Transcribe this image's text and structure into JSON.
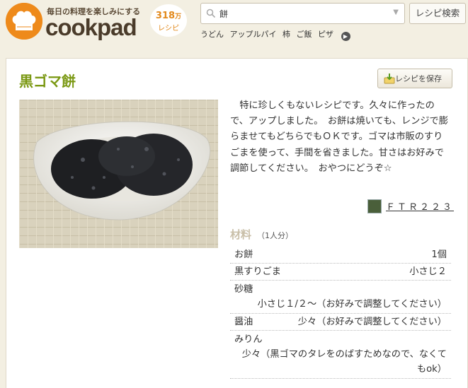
{
  "header": {
    "tagline": "毎日の料理を楽しみにする",
    "logo": "cookpad",
    "count_number": "318",
    "count_unit": "万",
    "count_label": "レシピ",
    "search_value": "餅",
    "search_button": "レシピ検索",
    "keywords": [
      "うどん",
      "アップルパイ",
      "柿",
      "ご飯",
      "ピザ"
    ]
  },
  "recipe": {
    "title": "黒ゴマ餅",
    "save_button": "レシピを保存",
    "description": "特に珍しくもないレシピです。久々に作ったので、アップしました。　お餅は焼いても、レンジで膨らませてもどちらでもＯＫです。ゴマは市販のすりごまを使って、手間を省きました。甘さはお好みで調節してください。　おやつにどうぞ☆",
    "author": "ＦＴＲ２２３"
  },
  "ingredients": {
    "heading": "材料",
    "servings": "（1人分）",
    "items": [
      {
        "name": "お餅",
        "qty": "1個"
      },
      {
        "name": "黒すりごま",
        "qty": "小さじ２"
      },
      {
        "name": "砂糖",
        "qty": "小さじ１/２～（お好みで調整してください）"
      },
      {
        "name": "醤油",
        "qty": "少々（お好みで調整してください）"
      },
      {
        "name": "みりん",
        "qty": "少々（黒ゴマのタレをのばすためなので、なくてもok）"
      }
    ]
  },
  "colors": {
    "title_green": "#7a9812",
    "brand_orange": "#ee8a1b",
    "page_bg": "#f3efe2"
  },
  "icons": [
    "chef-hat-icon",
    "search-icon",
    "dropdown-arrow-icon",
    "chevron-right-icon",
    "save-download-icon"
  ]
}
